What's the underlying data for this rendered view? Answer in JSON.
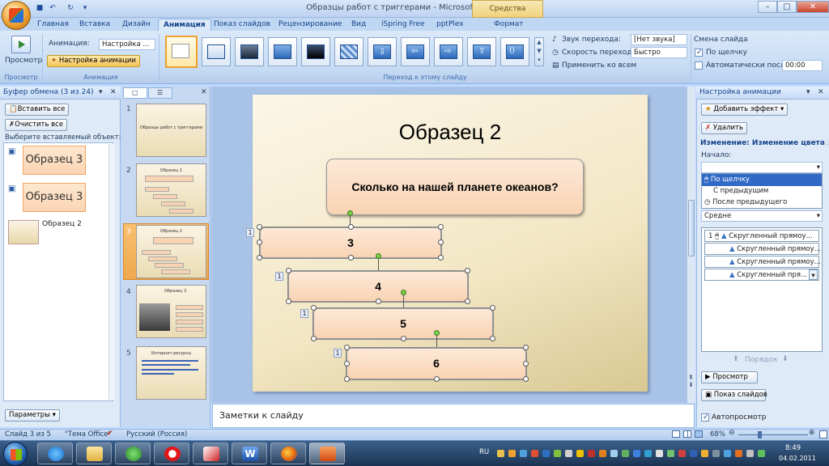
{
  "titlebar": {
    "title": "Образцы работ с триггерами - Microsoft PowerPoint",
    "context_tab": "Средства рисования",
    "minimize": "–",
    "maximize": "□",
    "close": "✕"
  },
  "tabs": [
    "Главная",
    "Вставка",
    "Дизайн",
    "Анимация",
    "Показ слайдов",
    "Рецензирование",
    "Вид",
    "iSpring Free",
    "pptPlex",
    "Формат"
  ],
  "ribbon": {
    "preview_label": "Просмотр",
    "animation_label": "Анимация:",
    "animation_value": "Настройка ...",
    "custom_animation_btn": "Настройка анимации",
    "group_preview": "Просмотр",
    "group_animation": "Анимация",
    "group_transition": "Переход к этому слайду",
    "sound_label": "Звук перехода:",
    "sound_value": "[Нет звука]",
    "speed_label": "Скорость перехода:",
    "speed_value": "Быстро",
    "apply_all": "Применить ко всем",
    "advance_title": "Смена слайда",
    "on_click": "По щелчку",
    "auto_after": "Автоматически после:",
    "auto_time": "00:00"
  },
  "clipboard": {
    "header": "Буфер обмена (3 из 24)",
    "paste_all": "Вставить все",
    "clear_all": "Очистить все",
    "choose": "Выберите вставляемый объект:",
    "items": [
      "Образец 3",
      "Образец 3",
      "Образец 2"
    ],
    "params": "Параметры"
  },
  "slides": [
    {
      "num": "1",
      "title": "Образцы работ с триггерами"
    },
    {
      "num": "2",
      "title": "Образец 1"
    },
    {
      "num": "3",
      "title": "Образец 2"
    },
    {
      "num": "4",
      "title": "Образец 3"
    },
    {
      "num": "5",
      "title": "Интернет-ресурсы"
    }
  ],
  "slide": {
    "title": "Образец 2",
    "question": "Сколько на нашей планете океанов?",
    "answers": [
      "3",
      "4",
      "5",
      "6"
    ],
    "anim_tags": [
      "1",
      "1",
      "1",
      "1"
    ]
  },
  "notes": "Заметки к слайду",
  "animpane": {
    "header": "Настройка анимации",
    "add_effect": "Добавить эффект",
    "remove": "Удалить",
    "change": "Изменение: Изменение цвета зали",
    "start_label": "Начало:",
    "start_options": [
      "По щелчку",
      "С предыдущим",
      "После предыдущего"
    ],
    "speed": "Средне",
    "list": [
      {
        "idx": "1",
        "label": "Скругленный прямоу..."
      },
      {
        "idx": "",
        "label": "Скругленный прямоу..."
      },
      {
        "idx": "",
        "label": "Скругленный прямоу..."
      },
      {
        "idx": "",
        "label": "Скругленный пря..."
      }
    ],
    "order": "Порядок",
    "play": "Просмотр",
    "slideshow": "Показ слайдов",
    "autopreview": "Автопросмотр"
  },
  "status": {
    "slide": "Слайд 3 из 5",
    "theme": "\"Тема Office\"",
    "lang": "Русский (Россия)",
    "zoom": "68%"
  },
  "taskbar": {
    "lang": "RU",
    "time": "8:49",
    "date": "04.02.2011"
  }
}
